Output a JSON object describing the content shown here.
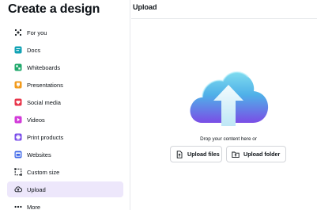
{
  "sidebar": {
    "title": "Create a design",
    "items": [
      {
        "label": "For you",
        "icon": "sparkle-grid-icon",
        "color": "#0e1318",
        "active": false
      },
      {
        "label": "Docs",
        "icon": "docs-icon",
        "color": "#13a3b5",
        "active": false
      },
      {
        "label": "Whiteboards",
        "icon": "whiteboard-icon",
        "color": "#1fa86b",
        "active": false
      },
      {
        "label": "Presentations",
        "icon": "presentation-icon",
        "color": "#f29b1d",
        "active": false
      },
      {
        "label": "Social media",
        "icon": "social-heart-icon",
        "color": "#e8364b",
        "active": false
      },
      {
        "label": "Videos",
        "icon": "video-icon",
        "color": "#d23bd9",
        "active": false
      },
      {
        "label": "Print products",
        "icon": "printer-icon",
        "color": "#7a4dea",
        "active": false
      },
      {
        "label": "Websites",
        "icon": "website-icon",
        "color": "#3c66e8",
        "active": false
      },
      {
        "label": "Custom size",
        "icon": "custom-size-icon",
        "color": "#0e1318",
        "active": false
      },
      {
        "label": "Upload",
        "icon": "cloud-upload-icon",
        "color": "#0e1318",
        "active": true
      },
      {
        "label": "More",
        "icon": "more-dots-icon",
        "color": "#0e1318",
        "active": false
      }
    ]
  },
  "main": {
    "title": "Upload",
    "drop_text": "Drop your content here or",
    "upload_files_label": "Upload files",
    "upload_folder_label": "Upload folder"
  },
  "colors": {
    "active_bg": "#ede7fb",
    "cloud_top": "#6fd5ea",
    "cloud_bottom": "#7b4fe6",
    "arrow": "#dff5fb"
  }
}
